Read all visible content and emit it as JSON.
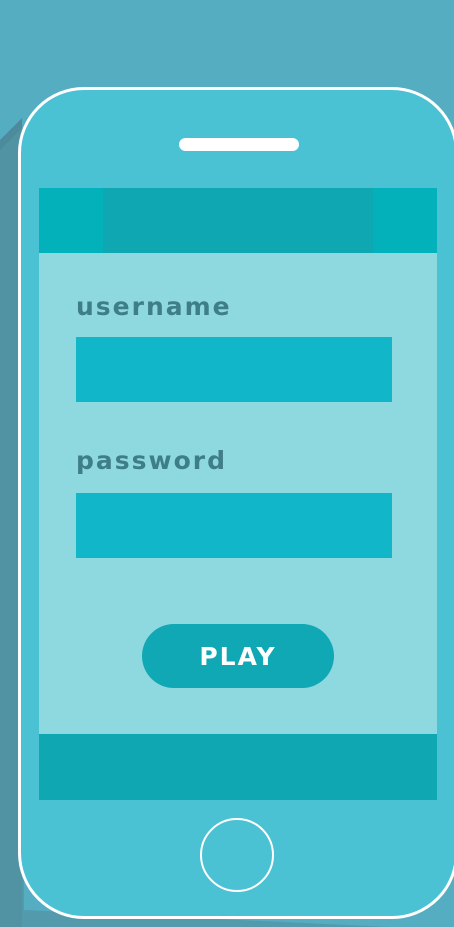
{
  "colors": {
    "background": "#55adc2",
    "phone_body": "#4ac2d3",
    "phone_outline": "#ffffff",
    "screen": "#8ed8df",
    "header_bar": "#03b1bb",
    "header_bar_center": "#0ea7b2",
    "label_text": "#3e7e88",
    "input_fill": "#12b6c9",
    "button_fill": "#10a8b4",
    "button_text": "#ffffff",
    "footer_bar": "#0ea7b2"
  },
  "login_form": {
    "username_label": "username",
    "username_value": "",
    "password_label": "password",
    "password_value": "",
    "play_label": "PLAY"
  },
  "icons": {
    "speaker": "phone-speaker-slot",
    "home_button": "phone-home-button"
  }
}
